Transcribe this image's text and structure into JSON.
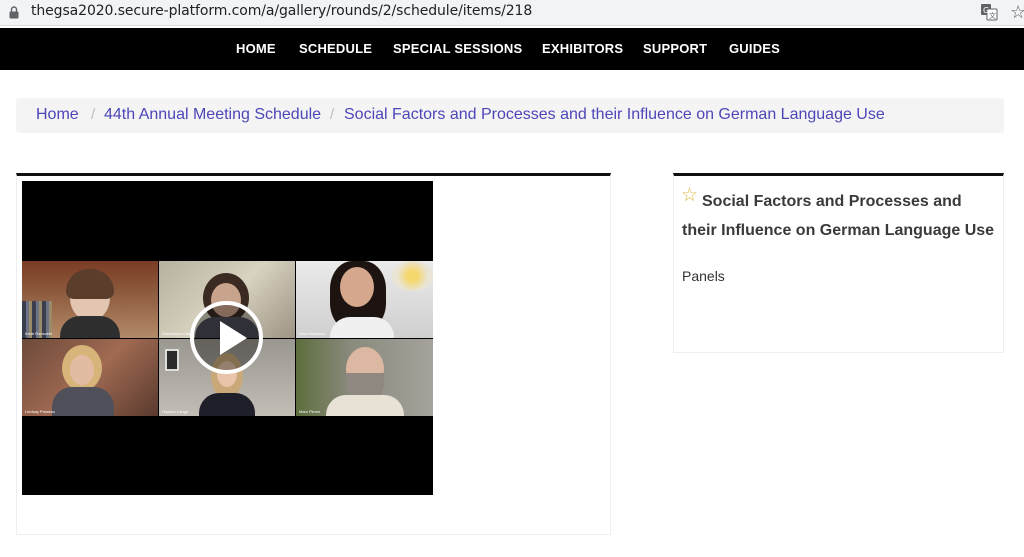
{
  "browser": {
    "url": "thegsa2020.secure-platform.com/a/gallery/rounds/2/schedule/items/218"
  },
  "nav": {
    "items": [
      {
        "label": "HOME"
      },
      {
        "label": "SCHEDULE"
      },
      {
        "label": "SPECIAL SESSIONS"
      },
      {
        "label": "EXHIBITORS"
      },
      {
        "label": "SUPPORT"
      },
      {
        "label": "GUIDES"
      }
    ]
  },
  "breadcrumb": {
    "items": [
      {
        "label": "Home"
      },
      {
        "label": "44th Annual Meeting Schedule"
      },
      {
        "label": "Social Factors and Processes and their Influence on German Language Use"
      }
    ],
    "separator": "/"
  },
  "video": {
    "participants": [
      {
        "name": "Irene Roosveld"
      },
      {
        "name": "Gianfranca Calvo"
      },
      {
        "name": "Nina Hörmann"
      },
      {
        "name": "Lindsay Preseau"
      },
      {
        "name": "Hayden Lange"
      },
      {
        "name": "Marc Pierce"
      }
    ]
  },
  "session": {
    "star_icon": "star-outline-icon",
    "title": "Social Factors and Processes and their Influence on German Language Use",
    "type": "Panels"
  },
  "colors": {
    "nav_bg": "#000000",
    "link": "#4c46b8",
    "star": "#e0b93e"
  }
}
